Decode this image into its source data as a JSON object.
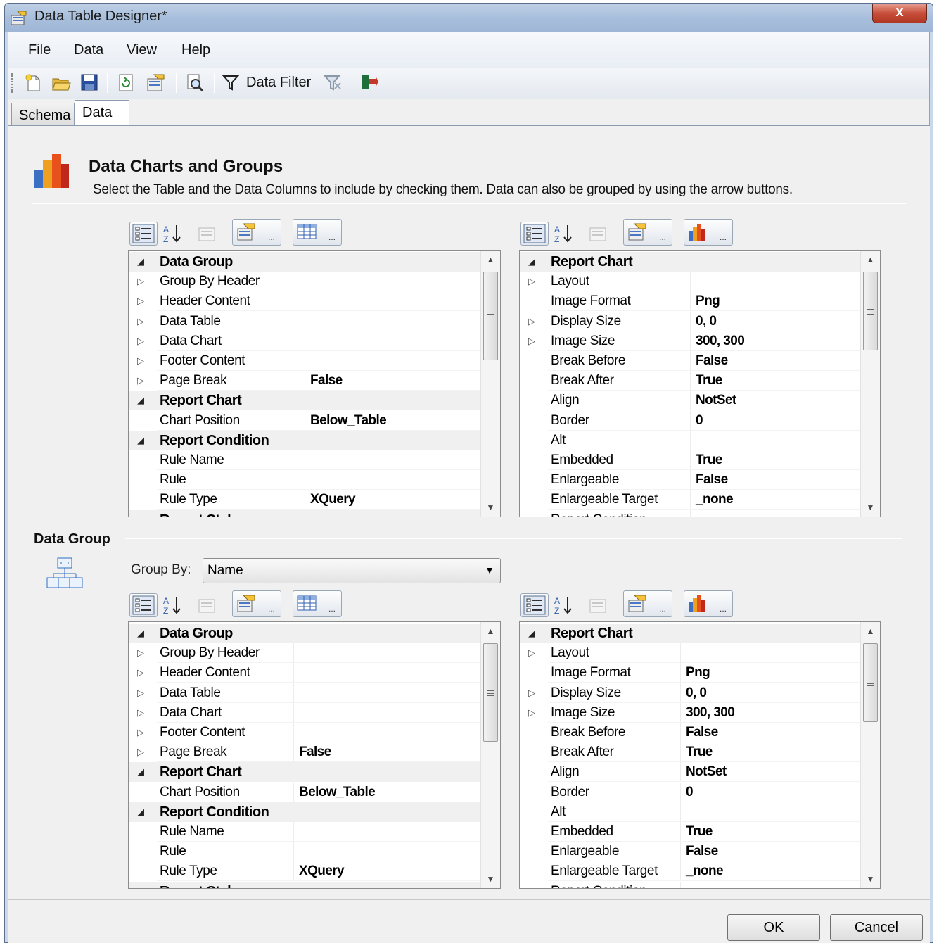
{
  "window": {
    "title": "Data Table Designer*",
    "close_glyph": "x"
  },
  "menu": [
    "File",
    "Data",
    "View",
    "Help"
  ],
  "toolbar": {
    "icons": [
      "new-icon",
      "open-folder-icon",
      "save-icon",
      "refresh-icon",
      "properties-icon",
      "preview-icon",
      "filter-icon",
      "clear-filter-icon",
      "export-icon"
    ],
    "data_filter_label": "Data Filter"
  },
  "tabs": [
    "Schema",
    "Data"
  ],
  "header": {
    "title": "Data Charts and Groups",
    "description": "Select the Table and the Data Columns to include by checking them. Data can also be grouped by using the arrow buttons."
  },
  "data_group": {
    "label": "Data Group",
    "group_by_label": "Group By:",
    "group_by_value": "Name"
  },
  "grid_toolbar": {
    "ellipsis": "..."
  },
  "left_grid": [
    {
      "type": "cat",
      "expander": "open",
      "name": "Data Group",
      "value": ""
    },
    {
      "type": "prop",
      "expander": "closed",
      "name": "Group By Header",
      "value": ""
    },
    {
      "type": "prop",
      "expander": "closed",
      "name": "Header Content",
      "value": ""
    },
    {
      "type": "prop",
      "expander": "closed",
      "name": "Data Table",
      "value": ""
    },
    {
      "type": "prop",
      "expander": "closed",
      "name": "Data Chart",
      "value": ""
    },
    {
      "type": "prop",
      "expander": "closed",
      "name": "Footer Content",
      "value": ""
    },
    {
      "type": "prop",
      "expander": "closed",
      "name": "Page Break",
      "value": "False"
    },
    {
      "type": "cat",
      "expander": "open",
      "name": "Report Chart",
      "value": ""
    },
    {
      "type": "prop",
      "expander": "",
      "name": "Chart Position",
      "value": "Below_Table"
    },
    {
      "type": "cat",
      "expander": "open",
      "name": "Report Condition",
      "value": ""
    },
    {
      "type": "prop",
      "expander": "",
      "name": "Rule Name",
      "value": ""
    },
    {
      "type": "prop",
      "expander": "",
      "name": "Rule",
      "value": ""
    },
    {
      "type": "prop",
      "expander": "",
      "name": "Rule Type",
      "value": "XQuery"
    },
    {
      "type": "cat",
      "expander": "open",
      "name": "Report Style",
      "value": ""
    }
  ],
  "right_grid": [
    {
      "type": "cat",
      "expander": "open",
      "name": "Report Chart",
      "value": ""
    },
    {
      "type": "prop",
      "expander": "closed",
      "name": "Layout",
      "value": ""
    },
    {
      "type": "prop",
      "expander": "",
      "name": "Image Format",
      "value": "Png"
    },
    {
      "type": "prop",
      "expander": "closed",
      "name": "Display Size",
      "value": "0, 0"
    },
    {
      "type": "prop",
      "expander": "closed",
      "name": "Image Size",
      "value": "300, 300"
    },
    {
      "type": "prop",
      "expander": "",
      "name": "Break Before",
      "value": "False"
    },
    {
      "type": "prop",
      "expander": "",
      "name": "Break After",
      "value": "True"
    },
    {
      "type": "prop",
      "expander": "",
      "name": "Align",
      "value": "NotSet"
    },
    {
      "type": "prop",
      "expander": "",
      "name": "Border",
      "value": "0"
    },
    {
      "type": "prop",
      "expander": "",
      "name": "Alt",
      "value": ""
    },
    {
      "type": "prop",
      "expander": "",
      "name": "Embedded",
      "value": "True"
    },
    {
      "type": "prop",
      "expander": "",
      "name": "Enlargeable",
      "value": "False"
    },
    {
      "type": "prop",
      "expander": "",
      "name": "Enlargeable Target",
      "value": "_none"
    },
    {
      "type": "prop",
      "expander": "",
      "name": "Report Condition",
      "value": ""
    }
  ],
  "buttons": {
    "ok": "OK",
    "cancel": "Cancel"
  }
}
